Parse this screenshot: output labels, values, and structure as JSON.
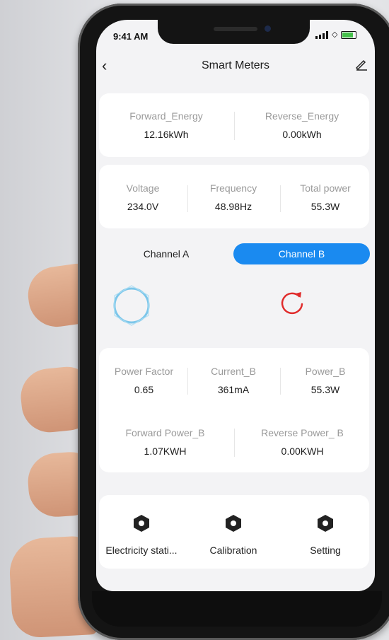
{
  "status": {
    "time": "9:41 AM"
  },
  "header": {
    "title": "Smart Meters"
  },
  "energy": {
    "forward_label": "Forward_Energy",
    "forward_value": "12.16kWh",
    "reverse_label": "Reverse_Energy",
    "reverse_value": "0.00kWh"
  },
  "grid": {
    "voltage_label": "Voltage",
    "voltage_value": "234.0V",
    "frequency_label": "Frequency",
    "frequency_value": "48.98Hz",
    "total_power_label": "Total power",
    "total_power_value": "55.3W"
  },
  "channels": {
    "a_label": "Channel A",
    "b_label": "Channel B",
    "selected": "Channel B"
  },
  "channel_b": {
    "power_factor_label": "Power Factor",
    "power_factor_value": "0.65",
    "current_label": "Current_B",
    "current_value": "361mA",
    "power_label": "Power_B",
    "power_value": "55.3W",
    "forward_power_label": "Forward Power_B",
    "forward_power_value": "1.07KWH",
    "reverse_power_label": "Reverse Power_ B",
    "reverse_power_value": "0.00KWH"
  },
  "tools": [
    {
      "label": "Electricity stati..."
    },
    {
      "label": "Calibration"
    },
    {
      "label": "Setting"
    }
  ],
  "colors": {
    "accent": "#1a8af0",
    "refresh": "#e02b2b",
    "ring": "#7cc6ea",
    "battery": "#45c04a"
  }
}
